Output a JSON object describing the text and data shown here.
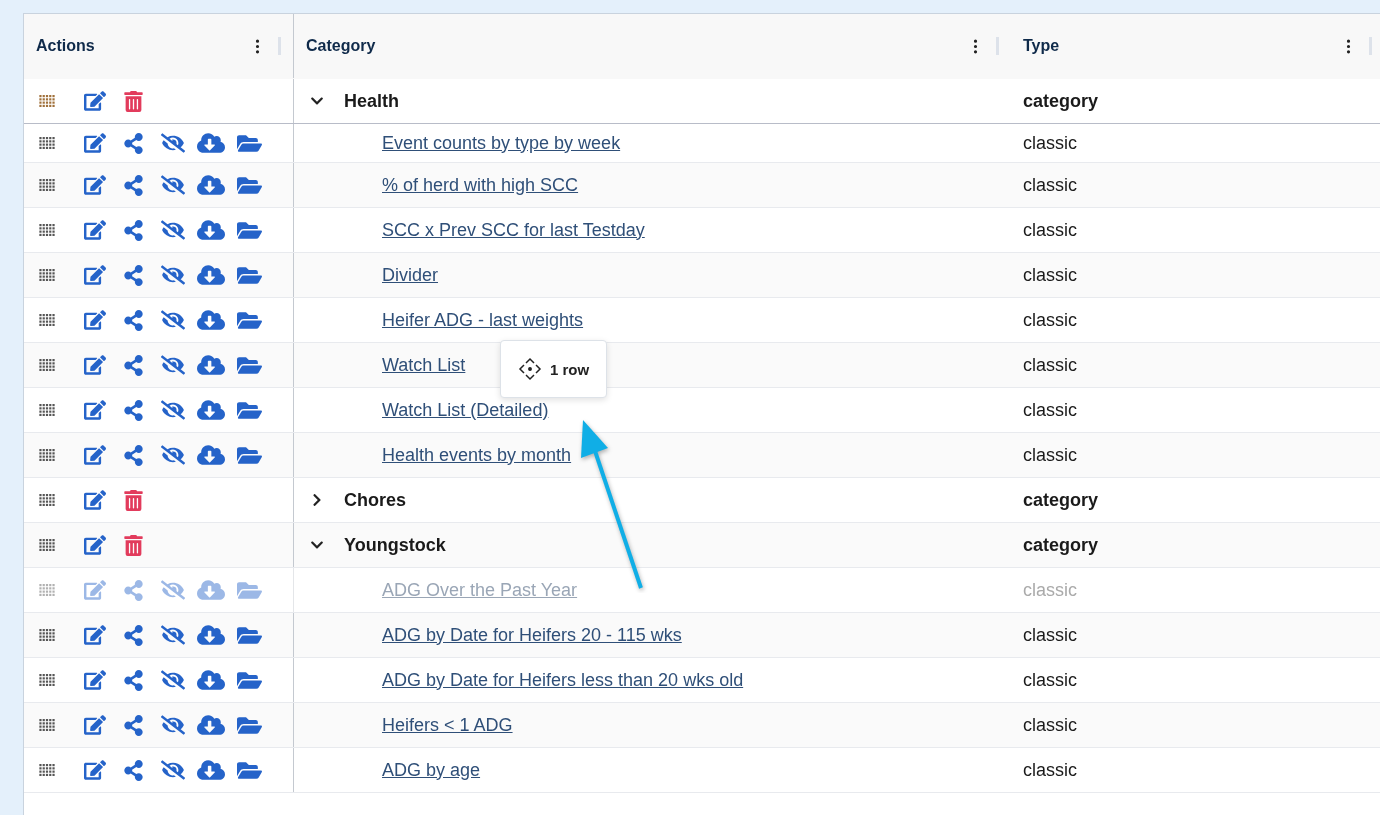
{
  "table": {
    "columns": [
      {
        "label": "Actions"
      },
      {
        "label": "Category"
      },
      {
        "label": "Type"
      }
    ],
    "rows": [
      {
        "kind": "category",
        "name": "Health",
        "type": "category",
        "expanded": true,
        "children": [
          {
            "kind": "report",
            "name": "Event counts by type by week",
            "type": "classic",
            "dragging": false
          },
          {
            "kind": "report",
            "name": "% of herd with high SCC",
            "type": "classic",
            "dragging": false
          },
          {
            "kind": "report",
            "name": "SCC x Prev SCC for last Testday",
            "type": "classic",
            "dragging": false
          },
          {
            "kind": "report",
            "name": "Divider",
            "type": "classic",
            "dragging": false
          },
          {
            "kind": "report",
            "name": "Heifer ADG - last weights",
            "type": "classic",
            "dragging": false
          },
          {
            "kind": "report",
            "name": "Watch List",
            "type": "classic",
            "dragging": false
          },
          {
            "kind": "report",
            "name": "Watch List (Detailed)",
            "type": "classic",
            "dragging": false
          },
          {
            "kind": "report",
            "name": "Health events by month",
            "type": "classic",
            "dragging": false
          }
        ]
      },
      {
        "kind": "category",
        "name": "Chores",
        "type": "category",
        "expanded": false
      },
      {
        "kind": "category",
        "name": "Youngstock",
        "type": "category",
        "expanded": true,
        "children": [
          {
            "kind": "report",
            "name": "ADG Over the Past Year",
            "type": "classic",
            "dragging": true
          },
          {
            "kind": "report",
            "name": "ADG by Date for Heifers 20 - 115 wks",
            "type": "classic",
            "dragging": false
          },
          {
            "kind": "report",
            "name": "ADG by Date for Heifers less than 20 wks old",
            "type": "classic",
            "dragging": false
          },
          {
            "kind": "report",
            "name": "Heifers < 1 ADG",
            "type": "classic",
            "dragging": false
          },
          {
            "kind": "report",
            "name": "ADG by age",
            "type": "classic",
            "dragging": false
          }
        ]
      }
    ]
  },
  "drag_preview": {
    "label": "1 row"
  }
}
